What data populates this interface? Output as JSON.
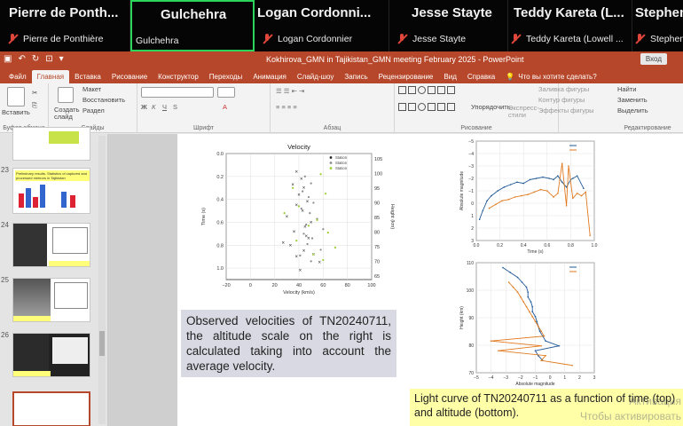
{
  "participants": [
    {
      "big": "Pierre de Ponth...",
      "small": "Pierre de Ponthière",
      "muted": true,
      "active": false
    },
    {
      "big": "Gulchehra",
      "small": "Gulchehra",
      "muted": false,
      "active": true
    },
    {
      "big": "Logan  Cordonni...",
      "small": "Logan Cordonnier",
      "muted": true,
      "active": false
    },
    {
      "big": "Jesse  Stayte",
      "small": "Jesse Stayte",
      "muted": true,
      "active": false
    },
    {
      "big": "Teddy  Kareta  (L...",
      "small": "Teddy Kareta (Lowell ...",
      "muted": true,
      "active": false
    },
    {
      "big": "Stephen",
      "small": "Stephen",
      "muted": true,
      "active": false
    }
  ],
  "window": {
    "title": "Kokhirova_GMN in Tajikistan_GMN meeting February 2025  -  PowerPoint",
    "login": "Вход"
  },
  "tabs": [
    "Файл",
    "Главная",
    "Вставка",
    "Рисование",
    "Конструктор",
    "Переходы",
    "Анимация",
    "Слайд-шоу",
    "Запись",
    "Рецензирование",
    "Вид",
    "Справка"
  ],
  "tell_me": "Что вы хотите сделать?",
  "ribbon": {
    "paste": "Вставить",
    "clipboard": "Буфер обмена",
    "new_slide": "Создать слайд",
    "layout": "Макет",
    "reset": "Восстановить",
    "section": "Раздел",
    "slides": "Слайды",
    "font": "Шрифт",
    "paragraph": "Абзац",
    "arrange": "Упорядочить",
    "quick_styles": "Экспресс-стили",
    "drawing": "Рисование",
    "fill": "Заливка фигуры",
    "outline": "Контур фигуры",
    "effects": "Эффекты фигуры",
    "find": "Найти",
    "replace": "Заменить",
    "select": "Выделить",
    "editing": "Редактирование"
  },
  "thumbnails": {
    "numbers": [
      "23",
      "24",
      "25",
      "26"
    ],
    "slide23_title": "Preliminary results. Statistics of captured and processed meteors in Tajikistan"
  },
  "slide": {
    "caption1": "Observed velocities of TN20240711, the altitude scale on the right is calculated taking into account the average velocity.",
    "caption2": "Light curve of TN20240711 as a function of time (top) and altitude (bottom).",
    "watermark1": "Активация",
    "watermark2": "Чтобы активировать"
  },
  "chart_data": [
    {
      "type": "scatter",
      "title": "Velocity",
      "xlabel": "Velocity (km/s)",
      "ylabel": "Time (s)",
      "y2label": "Height (km)",
      "xlim": [
        -20,
        100
      ],
      "ylim": [
        1.1,
        0.0
      ],
      "xticks": [
        "−20",
        "0",
        "20",
        "40",
        "60",
        "80",
        "100"
      ],
      "yticks": [
        "0.0",
        "0.2",
        "0.4",
        "0.6",
        "0.8",
        "1.0"
      ],
      "y2ticks": [
        "105",
        "100",
        "95",
        "90",
        "85",
        "80",
        "75",
        "70",
        "65"
      ],
      "legend": [
        "Station",
        "Station",
        "Station"
      ],
      "series": [
        {
          "x": [
            38,
            42,
            35,
            44,
            40,
            47,
            38,
            43,
            30,
            50,
            45,
            36,
            46,
            48,
            27,
            33,
            44,
            52,
            38,
            57,
            41
          ],
          "y": [
            0.16,
            0.22,
            0.27,
            0.3,
            0.36,
            0.42,
            0.45,
            0.5,
            0.55,
            0.6,
            0.64,
            0.68,
            0.72,
            0.74,
            0.78,
            0.8,
            0.85,
            0.88,
            0.9,
            0.95,
            1.02
          ]
        },
        {
          "x": [
            45,
            50,
            43,
            48,
            52,
            42,
            49,
            55,
            46,
            60,
            44,
            51,
            47,
            58,
            41,
            50
          ],
          "y": [
            0.2,
            0.26,
            0.33,
            0.38,
            0.43,
            0.48,
            0.52,
            0.57,
            0.62,
            0.66,
            0.7,
            0.74,
            0.79,
            0.84,
            0.89,
            0.94
          ]
        },
        {
          "x": [
            58,
            35,
            62,
            40,
            28,
            55,
            48,
            64,
            38,
            70,
            52,
            60
          ],
          "y": [
            0.18,
            0.3,
            0.35,
            0.46,
            0.52,
            0.58,
            0.63,
            0.69,
            0.76,
            0.82,
            0.88,
            0.93
          ]
        }
      ]
    },
    {
      "type": "line",
      "xlabel": "Time (s)",
      "ylabel": "Absolute magnitude",
      "xlim": [
        0.0,
        1.1
      ],
      "ylim": [
        -5,
        3
      ],
      "xticks": [
        "0.0",
        "0.2",
        "0.4",
        "0.6",
        "0.8",
        "1.0"
      ],
      "yticks": [
        "−5",
        "−4",
        "−3",
        "−2",
        "−1",
        "0",
        "1",
        "2",
        "3"
      ],
      "series": [
        {
          "x": [
            0.03,
            0.06,
            0.1,
            0.14,
            0.2,
            0.26,
            0.32,
            0.38,
            0.44,
            0.5,
            0.56,
            0.62,
            0.68,
            0.72,
            0.76,
            0.8,
            0.84,
            0.88,
            0.9,
            0.94,
            1.0
          ],
          "y": [
            1.3,
            0.6,
            -0.2,
            -0.6,
            -1.0,
            -1.3,
            -1.5,
            -1.7,
            -1.6,
            -1.9,
            -2.0,
            -2.1,
            -2.0,
            -1.9,
            -2.2,
            -1.7,
            -1.3,
            -1.9,
            -2.0,
            -2.2,
            -1.2
          ]
        },
        {
          "x": [
            0.12,
            0.18,
            0.24,
            0.3,
            0.36,
            0.42,
            0.48,
            0.54,
            0.6,
            0.66,
            0.72,
            0.76,
            0.8,
            0.84,
            0.86,
            0.9,
            0.94,
            0.98,
            1.02,
            1.06
          ],
          "y": [
            0.4,
            0.1,
            -0.2,
            -0.3,
            -0.5,
            -0.6,
            -0.7,
            -0.9,
            -1.1,
            -1.0,
            -0.5,
            -0.8,
            -3.2,
            0.2,
            -3.0,
            -0.4,
            -0.8,
            -0.6,
            -0.9,
            2.6
          ]
        }
      ]
    },
    {
      "type": "line",
      "xlabel": "Absolute magnitude",
      "ylabel": "Height (km)",
      "xlim": [
        -5,
        3
      ],
      "ylim": [
        65,
        110
      ],
      "xticks": [
        "−5",
        "−4",
        "−3",
        "−2",
        "−1",
        "0",
        "1",
        "2",
        "3"
      ],
      "yticks": [
        "70",
        "80",
        "90",
        "100",
        "110"
      ],
      "series": [
        {
          "x": [
            -3.2,
            -2.7,
            -2.2,
            -1.9,
            -1.6,
            -1.5,
            -1.5,
            -1.3,
            -1.2,
            -1.2,
            -1.0,
            -0.9,
            -0.8,
            -0.7,
            -0.5,
            -0.3,
            0.6,
            -1.0,
            -0.8,
            -0.5
          ],
          "y": [
            108,
            106,
            104,
            102,
            100,
            98,
            96,
            94,
            92,
            90,
            88,
            86,
            84,
            82,
            80,
            78,
            76,
            74,
            72,
            70
          ]
        },
        {
          "x": [
            -2.8,
            -2.5,
            -2.2,
            -2.0,
            -1.8,
            -1.6,
            -1.4,
            -1.2,
            -1.0,
            -0.8,
            -0.6,
            -0.4,
            -4.0,
            -0.6,
            -3.5,
            -0.3,
            -0.6,
            1.5
          ],
          "y": [
            102,
            100,
            98,
            96,
            94,
            92,
            90,
            88,
            86,
            84,
            82,
            80,
            78,
            76,
            74,
            72,
            70,
            68
          ]
        }
      ]
    }
  ],
  "colors": {
    "accent": "#b7472a",
    "active_tile": "#2bd55c",
    "muted": "#e0463a",
    "series_blue": "#1f5a96",
    "series_orange": "#e07a1f",
    "series_green": "#8cc24a",
    "caption1_bg": "#d9d9e3",
    "caption2_bg": "#ffffa8"
  }
}
